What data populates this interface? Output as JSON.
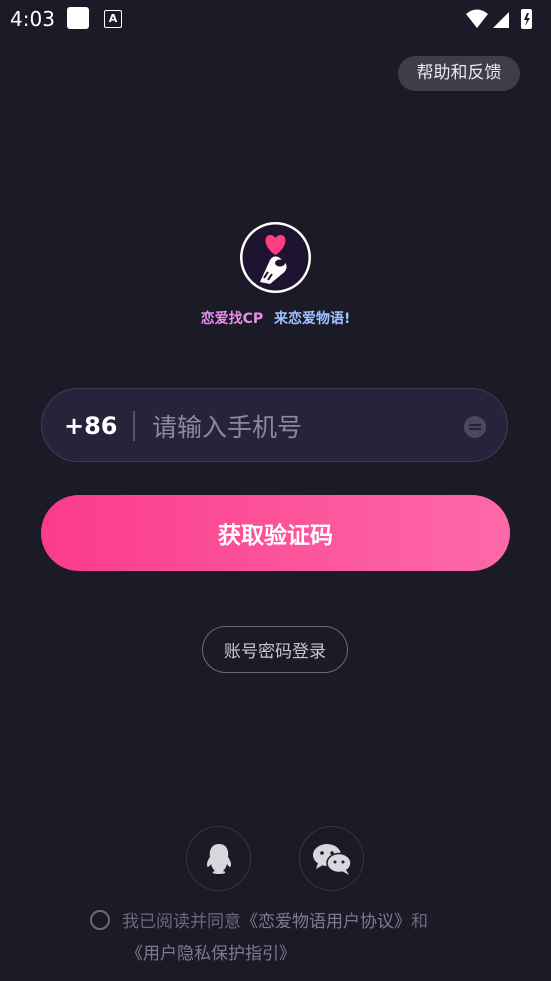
{
  "status_bar": {
    "time": "4:03",
    "notif_icon": "A"
  },
  "header": {
    "help_label": "帮助和反馈"
  },
  "brand": {
    "slogan_part1": "恋爱找CP",
    "slogan_part2": "来恋爱物语!"
  },
  "phone": {
    "country_code": "+86",
    "placeholder": "请输入手机号"
  },
  "actions": {
    "get_code_label": "获取验证码",
    "password_login_label": "账号密码登录"
  },
  "social": {
    "items": [
      "qq-icon",
      "wechat-icon"
    ]
  },
  "agreement": {
    "prefix": "我已阅读并同意",
    "link1": "《恋爱物语用户协议》",
    "and": "和",
    "link2": "《用户隐私保护指引》"
  },
  "colors": {
    "background": "#1b1a27",
    "accent_start": "#fb3b8b",
    "accent_end": "#fd69a8",
    "heart": "#ff3d7f"
  }
}
